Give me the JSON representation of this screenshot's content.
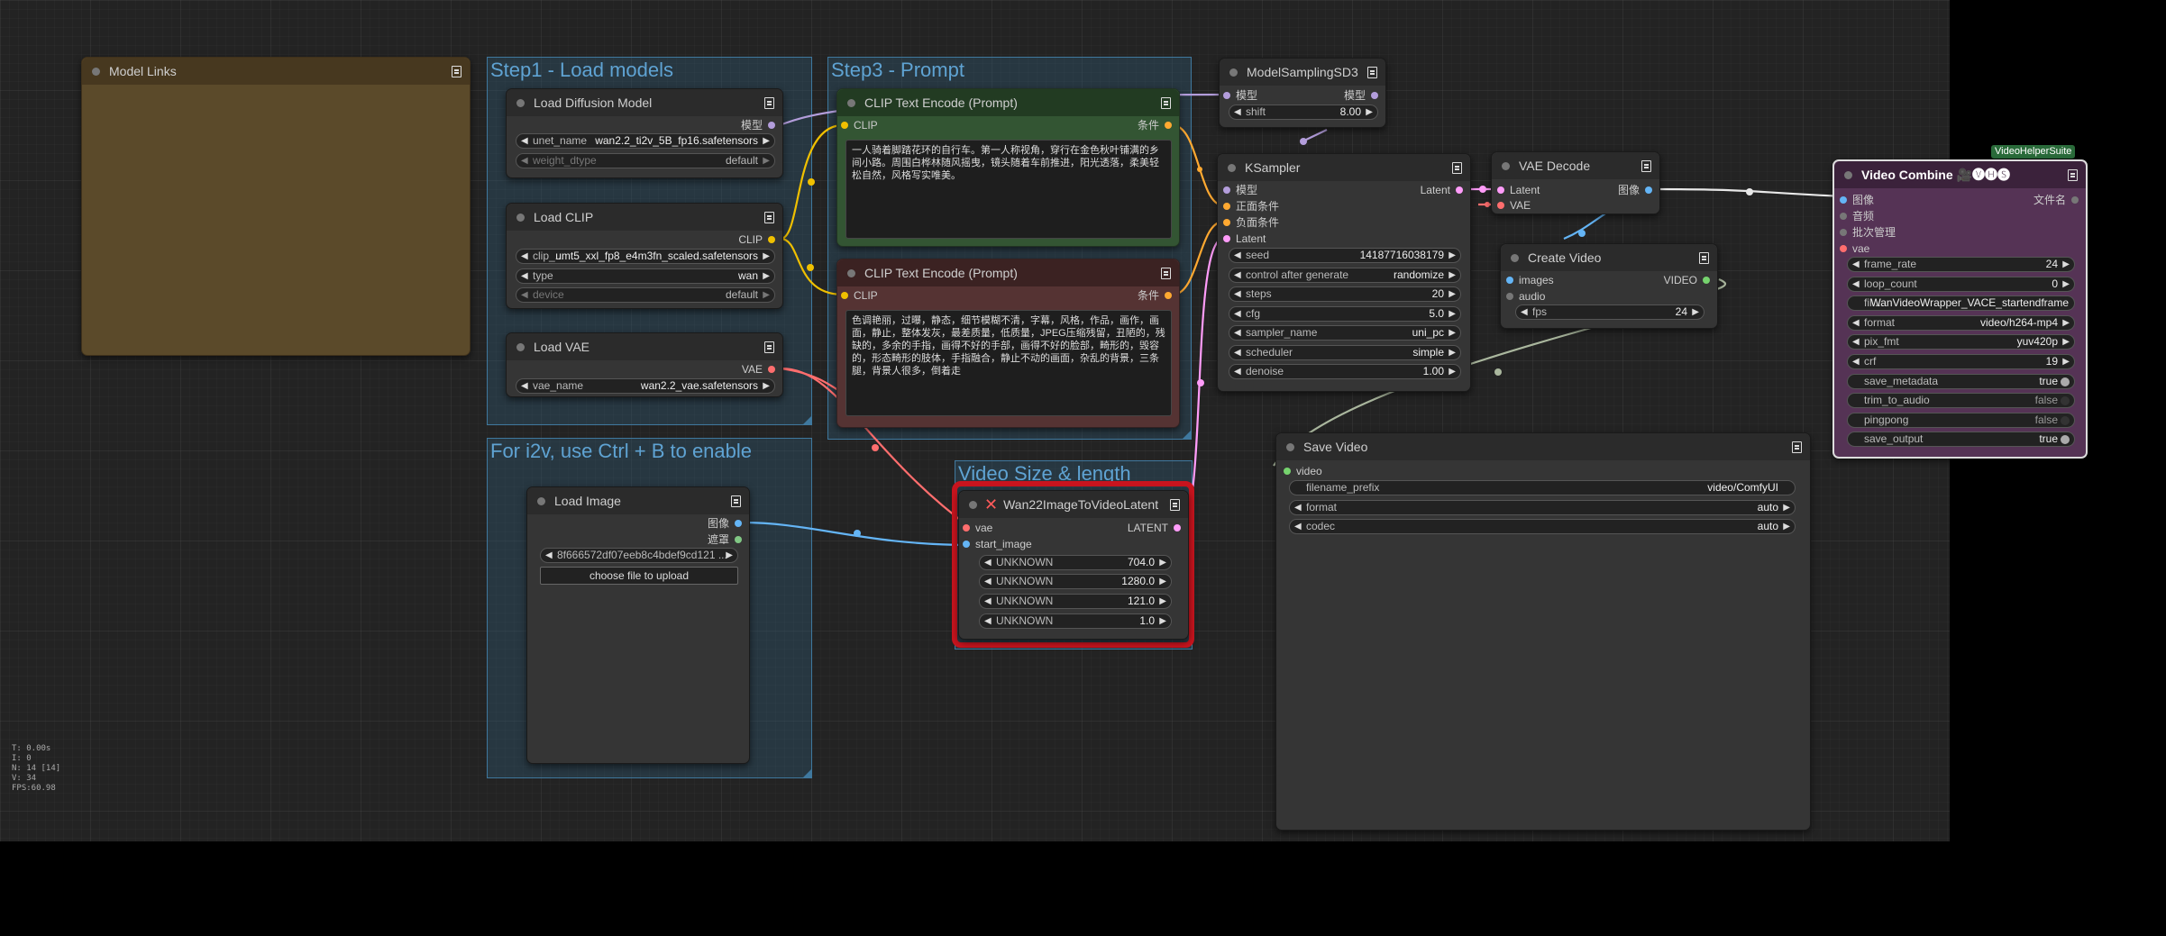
{
  "colors": {
    "canvas": "#232323",
    "group": "#3f789e",
    "clip_link": "#f0c000",
    "model_link": "#b39ddb",
    "vae_link": "#ff6e6e",
    "image_link": "#64b5f6",
    "latent_link": "#ff9cf9",
    "cond_link": "#ffa931",
    "video_link": "#aab79e",
    "highlight": "#c8141e"
  },
  "groups": {
    "step1": "Step1 - Load models",
    "step3": "Step3 - Prompt",
    "i2v": "For i2v, use Ctrl + B to enable",
    "video_size": "Video Size & length"
  },
  "model_links": {
    "title": "Model Links"
  },
  "load_diffusion": {
    "title": "Load Diffusion Model",
    "out": "模型",
    "w1_label": "unet_name",
    "w1_value": "wan2.2_ti2v_5B_fp16.safetensors",
    "w2_label": "weight_dtype",
    "w2_value": "default"
  },
  "load_clip": {
    "title": "Load CLIP",
    "out": "CLIP",
    "w1_label": "clip_...",
    "w1_value": "umt5_xxl_fp8_e4m3fn_scaled.safetensors",
    "w2_label": "type",
    "w2_value": "wan",
    "w3_label": "device",
    "w3_value": "default"
  },
  "load_vae": {
    "title": "Load VAE",
    "out": "VAE",
    "w1_label": "vae_name",
    "w1_value": "wan2.2_vae.safetensors"
  },
  "clip_pos": {
    "title": "CLIP Text Encode (Prompt)",
    "in": "CLIP",
    "out": "条件",
    "text": "一人骑着脚踏花环的自行车。第一人称视角，穿行在金色秋叶铺满的乡间小路。周围白桦林随风摇曳，镜头随着车前推进，阳光透落，柔美轻松自然，风格写实唯美。"
  },
  "clip_neg": {
    "title": "CLIP Text Encode (Prompt)",
    "in": "CLIP",
    "out": "条件",
    "text": "色调艳丽，过曝，静态，细节模糊不清，字幕，风格，作品，画作，画面，静止，整体发灰，最差质量，低质量，JPEG压缩残留，丑陋的，残缺的，多余的手指，画得不好的手部，画得不好的脸部，畸形的，毁容的，形态畸形的肢体，手指融合，静止不动的画面，杂乱的背景，三条腿，背景人很多，倒着走"
  },
  "load_image": {
    "title": "Load Image",
    "out1": "图像",
    "out2": "遮罩",
    "image_value": "8f666572df07eeb8c4bdef9cd121 ...",
    "upload_label": "choose file to upload"
  },
  "wan22": {
    "title": "Wan22ImageToVideoLatent",
    "in1": "vae",
    "in2": "start_image",
    "out": "LATENT",
    "w1_label": "UNKNOWN",
    "w1_value": "704.0",
    "w2_label": "UNKNOWN",
    "w2_value": "1280.0",
    "w3_label": "UNKNOWN",
    "w3_value": "121.0",
    "w4_label": "UNKNOWN",
    "w4_value": "1.0"
  },
  "model_sampling": {
    "title": "ModelSamplingSD3",
    "in": "模型",
    "out": "模型",
    "w1_label": "shift",
    "w1_value": "8.00"
  },
  "ksampler": {
    "title": "KSampler",
    "in1": "模型",
    "in2": "正面条件",
    "in3": "负面条件",
    "in4": "Latent",
    "out": "Latent",
    "seed_label": "seed",
    "seed_value": "141877160381​79",
    "cag_label": "control after generate",
    "cag_value": "randomize",
    "steps_label": "steps",
    "steps_value": "20",
    "cfg_label": "cfg",
    "cfg_value": "5.0",
    "sampler_label": "sampler_name",
    "sampler_value": "uni_pc",
    "scheduler_label": "scheduler",
    "scheduler_value": "simple",
    "denoise_label": "denoise",
    "denoise_value": "1.00"
  },
  "vae_decode": {
    "title": "VAE Decode",
    "in1": "Latent",
    "in2": "VAE",
    "out": "图像"
  },
  "create_video": {
    "title": "Create Video",
    "in1": "images",
    "in2": "audio",
    "out": "VIDEO",
    "w1_label": "fps",
    "w1_value": "24"
  },
  "save_video": {
    "title": "Save Video",
    "in": "video",
    "w1_label": "filename_prefix",
    "w1_value": "video/ComfyUI",
    "w2_label": "format",
    "w2_value": "auto",
    "w3_label": "codec",
    "w3_value": "auto"
  },
  "video_combine": {
    "badge": "VideoHelperSuite",
    "title": "Video Combine 🎥🅥🅗🅢",
    "in1": "图像",
    "in2": "音频",
    "in3": "批次管理",
    "in4": "vae",
    "out": "文件名",
    "frame_rate_label": "frame_rate",
    "frame_rate_value": "24",
    "loop_label": "loop_count",
    "loop_value": "0",
    "prefix_label": "fil ...",
    "prefix_value": "WanVideoWrapper_VACE_startendframe",
    "format_label": "format",
    "format_value": "video/h264-mp4",
    "pix_label": "pix_fmt",
    "pix_value": "yuv420p",
    "crf_label": "crf",
    "crf_value": "19",
    "meta_label": "save_metadata",
    "meta_value": "true",
    "trim_label": "trim_to_audio",
    "trim_value": "false",
    "ping_label": "pingpong",
    "ping_value": "false",
    "save_label": "save_output",
    "save_value": "true"
  },
  "stats": {
    "t": "T: 0.00s",
    "i": "I: 0",
    "n": "N: 14 [14]",
    "v": "V: 34",
    "fps": "FPS:60.98"
  }
}
